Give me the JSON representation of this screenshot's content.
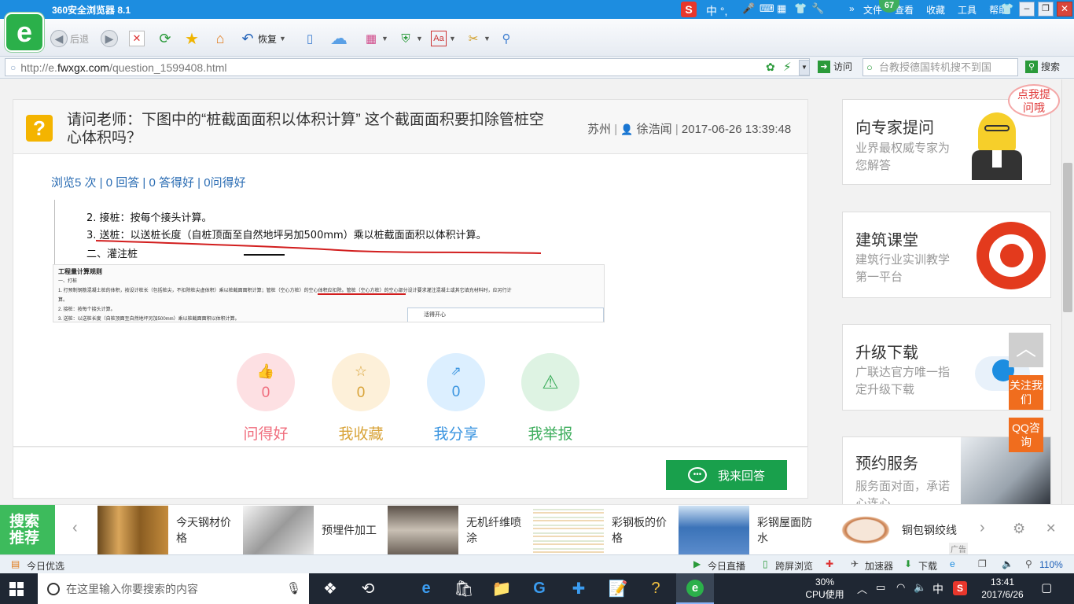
{
  "browser": {
    "title": "360安全浏览器 8.1",
    "right_menu": [
      "文件",
      "查看",
      "收藏",
      "工具",
      "帮助"
    ],
    "ime_text": "中 °,",
    "badge": "67",
    "toolbar": {
      "back_label": "后退",
      "restore_label": "恢复"
    },
    "address": {
      "scheme": "http://e.",
      "host": "fwxgx.com",
      "path": "/question_1599408.html"
    },
    "visit_label": "访问",
    "search_placeholder": "台教授德国转机搜不到国",
    "search_label": "搜索"
  },
  "question": {
    "title": "请问老师：下图中的“桩截面面积以体积计算” 这个截面面积要扣除管桩空心体积吗？",
    "location": "苏州",
    "author": "徐浩闻",
    "datetime": "2017-06-26 13:39:48",
    "stats": "浏览5 次 | 0 回答 | 0 答得好 | 0问得好"
  },
  "attachment": {
    "line1": "2. 接桩：按每个接头计算。",
    "line2": "3. 送桩：以送桩长度（自桩顶面至自然地坪另加500mm）乘以桩截面面积以体积计算。",
    "line3": "二、灌注桩",
    "doc_heading": "工程量计算规则",
    "doc_sub": "一、打桩",
    "doc_line1": "1. 打预制钢筋混凝土桩的体积，按设计桩长（包括桩尖，不扣除桩尖虚体积）乘以桩截面面积计算；管桩（空心方桩）的空心体积应扣除。管桩（空心方桩）的空心部分设计要求灌注混凝土或其它填充材料时，应另行计",
    "doc_line1b": "算。",
    "doc_line2": "2. 接桩：按每个接头计算。",
    "doc_line3": "3. 送桩：以送桩长度（自桩顶面至自然地坪另加500mm）乘以桩截面面积以体积计算。",
    "chat_title": "活得开心"
  },
  "actions": [
    {
      "label": "问得好",
      "count": "0"
    },
    {
      "label": "我收藏",
      "count": "0"
    },
    {
      "label": "我分享",
      "count": "0"
    },
    {
      "label": "我举报",
      "count": ""
    }
  ],
  "answer_button": "我来回答",
  "sidebar": {
    "sticker": "点我提问哦",
    "cards": [
      {
        "title": "向专家提问",
        "sub": "业界最权威专家为您解答"
      },
      {
        "title": "建筑课堂",
        "sub": "建筑行业实训教学第一平台"
      },
      {
        "title": "升级下载",
        "sub": "广联达官方唯一指定升级下载"
      },
      {
        "title": "预约服务",
        "sub": "服务面对面，承诺心连心"
      }
    ],
    "follow_label": "关注我们",
    "qq_label": "QQ咨询"
  },
  "search_rec": {
    "label": "搜索推荐",
    "items": [
      "今天钢材价格",
      "预埋件加工",
      "无机纤维喷涂",
      "彩钢板的价格",
      "彩钢屋面防水",
      "铜包钢绞线"
    ],
    "ad": "广告"
  },
  "statusbar": {
    "left": "今日优选",
    "live": "今日直播",
    "cross": "跨屏浏览",
    "accel": "加速器",
    "download": "下载",
    "zoom": "110%"
  },
  "taskbar": {
    "search_placeholder": "在这里输入你要搜索的内容",
    "cpu_pct": "30%",
    "cpu_label": "CPU使用",
    "ime": "中",
    "time": "13:41",
    "date": "2017/6/26"
  },
  "colors": {
    "good": "#f06e7e",
    "collect": "#d9a43a",
    "share": "#3b95e0",
    "report": "#3fae5e",
    "browser_blue": "#1d8de0",
    "answer_green": "#19a04c"
  }
}
